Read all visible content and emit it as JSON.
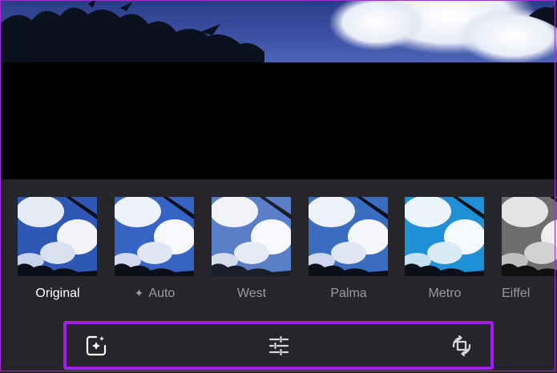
{
  "filters": [
    {
      "label": "Original",
      "selected": true
    },
    {
      "label": "Auto",
      "selected": false,
      "icon": "sparkle-icon"
    },
    {
      "label": "West",
      "selected": false
    },
    {
      "label": "Palma",
      "selected": false
    },
    {
      "label": "Metro",
      "selected": false
    },
    {
      "label": "Eiffel",
      "selected": false
    }
  ],
  "toolbar": {
    "tools": [
      {
        "name": "auto-enhance",
        "icon": "auto-enhance-icon"
      },
      {
        "name": "adjust",
        "icon": "sliders-icon"
      },
      {
        "name": "crop-rotate",
        "icon": "crop-rotate-icon"
      }
    ]
  },
  "colors": {
    "background": "#26262a",
    "highlight": "#a020e8",
    "selected_label": "#ffffff",
    "label": "#9a9aa0"
  }
}
